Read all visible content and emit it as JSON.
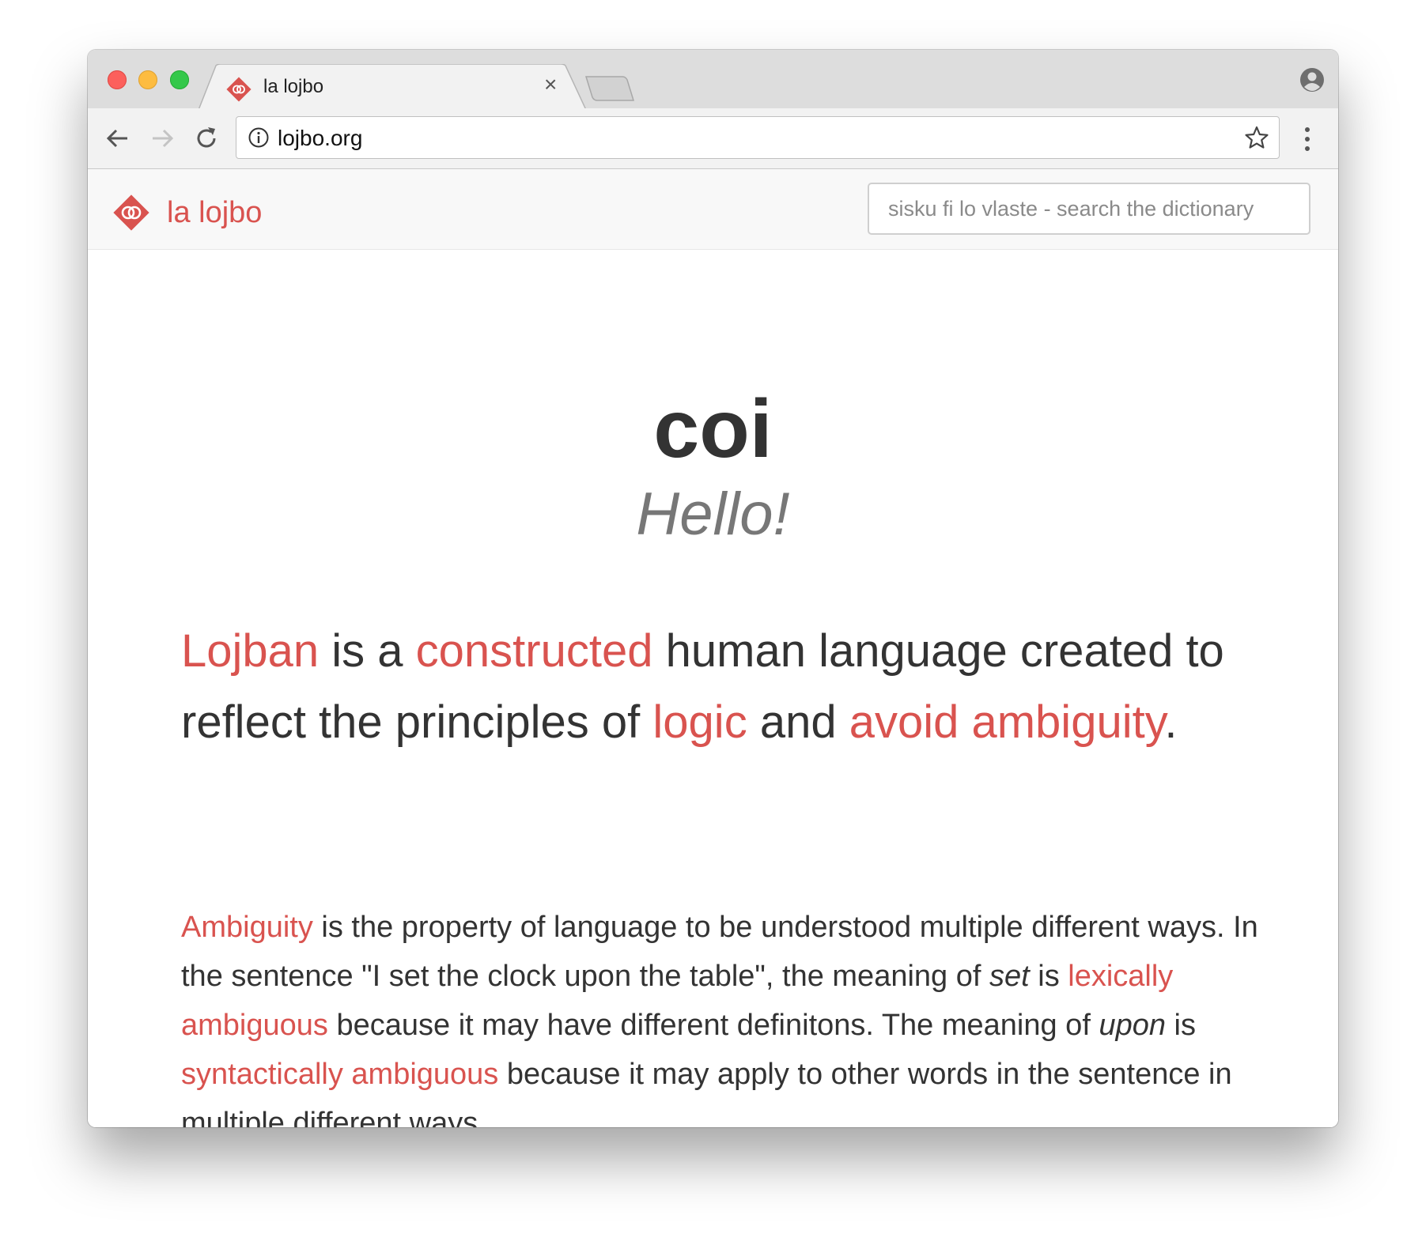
{
  "browser": {
    "tab_title": "la lojbo",
    "tab_close": "×",
    "url": "lojbo.org"
  },
  "navbar": {
    "brand": "la lojbo",
    "search_placeholder": "sisku fi lo vlaste - search the dictionary"
  },
  "hero": {
    "title": "coi",
    "subtitle": "Hello!"
  },
  "lead": {
    "p1_link_lojban": "Lojban",
    "p1_t1": " is a ",
    "p1_link_constructed": "constructed",
    "p1_t2": " human language created to reflect the principles of ",
    "p1_link_logic": "logic",
    "p1_t3": " and ",
    "p1_link_avoid_ambiguity": "avoid ambiguity",
    "p1_t4": "."
  },
  "body": {
    "link_ambiguity": "Ambiguity",
    "t1": " is the property of language to be understood multiple different ways. In the sentence \"I set the clock upon the table\", the meaning of ",
    "em_set": "set",
    "t2": " is ",
    "link_lexically": "lexically ambiguous",
    "t3": " because it may have different definitons. The meaning of ",
    "em_upon": "upon",
    "t4": " is ",
    "link_syntactically": "syntactically ambiguous",
    "t5": " because it may apply to other words in the sentence in multiple different ways."
  },
  "colors": {
    "accent": "#d9534f",
    "text": "#333333",
    "muted": "#777777"
  }
}
